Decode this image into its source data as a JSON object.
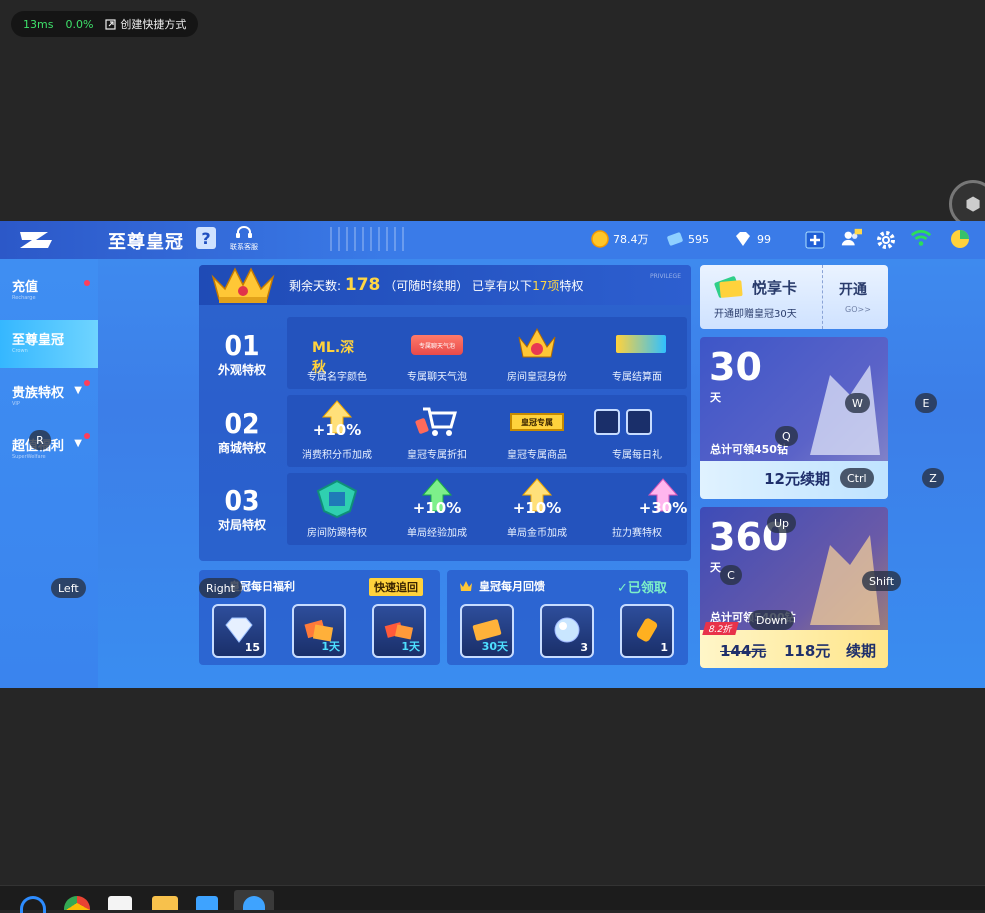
{
  "overlay": {
    "latency": "13ms",
    "percent": "0.0%",
    "shortcut": "创建快捷方式"
  },
  "topbar": {
    "title": "至尊皇冠",
    "help": "?",
    "service": "联系客服",
    "coins": "78.4万",
    "tickets": "595",
    "diamonds": "99"
  },
  "sidebar": {
    "items": [
      {
        "label": "充值",
        "sub": "Recharge"
      },
      {
        "label": "至尊皇冠",
        "sub": "Crown"
      },
      {
        "label": "贵族特权",
        "sub": "VIP"
      },
      {
        "label": "超值福利",
        "sub": "SuperWelfare"
      }
    ]
  },
  "panel": {
    "remain_label": "剩余天数:",
    "remain_days": "178",
    "renew": "（可随时续期）",
    "enjoy_pre": "已享有以下",
    "enjoy_num": "17项",
    "enjoy_post": "特权",
    "privilege": "PRIVILEGE",
    "rows": [
      {
        "num": "01",
        "title": "外观特权",
        "cells": [
          "专属名字颜色",
          "专属聊天气泡",
          "房间皇冠身份",
          "专属结算面"
        ]
      },
      {
        "num": "02",
        "title": "商城特权",
        "cells": [
          "消费积分币加成",
          "皇冠专属折扣",
          "皇冠专属商品",
          "专属每日礼"
        ]
      },
      {
        "num": "03",
        "title": "对局特权",
        "cells": [
          "房间防踢特权",
          "单局经验加成",
          "单局金币加成",
          "拉力赛特权"
        ]
      }
    ],
    "icon_texts": {
      "name_color": "ML.深秋",
      "bubble": "专属聊天气泡",
      "goods": "皇冠专属",
      "plus10a": "+10%",
      "plus10b": "+10%",
      "plus10c": "+10%",
      "plus30": "+30%"
    }
  },
  "daily": {
    "title": "皇冠每日福利",
    "quick": "快速追回",
    "items": [
      {
        "count": "15"
      },
      {
        "count": "1天"
      },
      {
        "count": "1天"
      }
    ]
  },
  "monthly": {
    "title": "皇冠每月回馈",
    "claimed": "已领取",
    "items": [
      {
        "count": "30天"
      },
      {
        "count": "3"
      },
      {
        "count": "1"
      }
    ]
  },
  "yuexiang": {
    "title": "悦享卡",
    "sub": "开通即赠皇冠30天",
    "open": "开通",
    "go": "GO>>"
  },
  "plan30": {
    "days": "30",
    "unit": "天",
    "total": "总计可领450钻",
    "price": "12元续期"
  },
  "plan360": {
    "days": "360",
    "unit": "天",
    "total": "总计可领5400钻",
    "discount": "8.2折",
    "old_price": "144元",
    "price": "118元",
    "action": "续期"
  },
  "keys": [
    "R",
    "Left",
    "Right",
    "Q",
    "W",
    "E",
    "Ctrl",
    "Z",
    "Up",
    "C",
    "Shift",
    "Down"
  ]
}
